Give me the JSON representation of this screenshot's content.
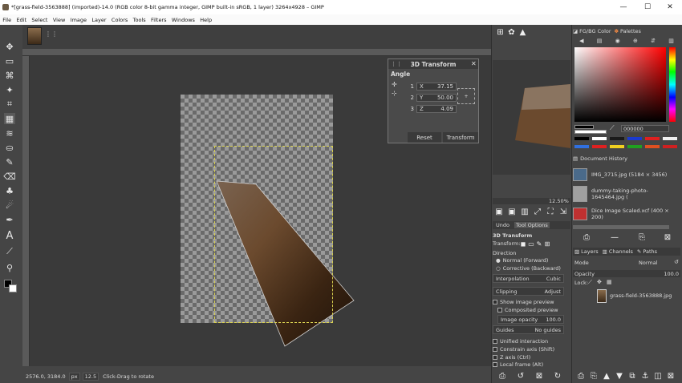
{
  "window": {
    "title": "*[grass-field-3563888] (imported)-14.0 (RGB color 8-bit gamma integer, GIMP built-in sRGB, 1 layer) 3264x4928 – GIMP",
    "minimize": "—",
    "maximize": "☐",
    "close": "✕"
  },
  "menu": [
    "File",
    "Edit",
    "Select",
    "View",
    "Image",
    "Layer",
    "Colors",
    "Tools",
    "Filters",
    "Windows",
    "Help"
  ],
  "dialog": {
    "title": "3D Transform",
    "section": "Angle",
    "rows": [
      {
        "num": "1",
        "axis": "X",
        "value": "37.15"
      },
      {
        "num": "2",
        "axis": "Y",
        "value": "50.00"
      },
      {
        "num": "3",
        "axis": "Z",
        "value": "4.09"
      }
    ],
    "reset_label": "Reset",
    "transform_label": "Transform"
  },
  "status": {
    "coords": "2576.0, 3184.0",
    "unit": "px",
    "zoom": "12.5",
    "hint": "Click-Drag to rotate"
  },
  "navigator": {
    "zoom": "12.50%"
  },
  "tool_options": {
    "undo_tab": "Undo",
    "options_tab": "Tool Options",
    "title": "3D Transform",
    "transform_label": "Transform:",
    "direction_label": "Direction",
    "normal": "Normal (Forward)",
    "corrective": "Corrective (Backward)",
    "interpolation_label": "Interpolation",
    "interpolation_value": "Cubic",
    "clipping_label": "Clipping",
    "clipping_value": "Adjust",
    "show_preview": "Show image preview",
    "composited": "Composited preview",
    "opacity_label": "Image opacity",
    "opacity_value": "100.0",
    "guides_label": "Guides",
    "guides_value": "No guides",
    "unified": "Unified interaction",
    "constrain": "Constrain axis (Shift)",
    "zaxis": "Z axis (Ctrl)",
    "local": "Local frame (Alt)"
  },
  "colors": {
    "tab_fg_bg": "FG/BG Color",
    "tab_palettes": "Palettes",
    "hex": "000000",
    "fg": "#000000",
    "bg": "#ffffff"
  },
  "history": {
    "title": "Document History",
    "items": [
      {
        "name": "IMG_3715.jpg (5184 × 3456)"
      },
      {
        "name": "dummy-taking-photo-1645464.jpg ("
      },
      {
        "name": "Dice Image Scaled.xcf (400 × 200)"
      }
    ]
  },
  "layers": {
    "layers_tab": "Layers",
    "channels_tab": "Channels",
    "paths_tab": "Paths",
    "mode_label": "Mode",
    "mode_value": "Normal",
    "opacity_label": "Opacity",
    "opacity_value": "100.0",
    "lock_label": "Lock:",
    "layer_name": "grass-field-3563888.jpg"
  }
}
